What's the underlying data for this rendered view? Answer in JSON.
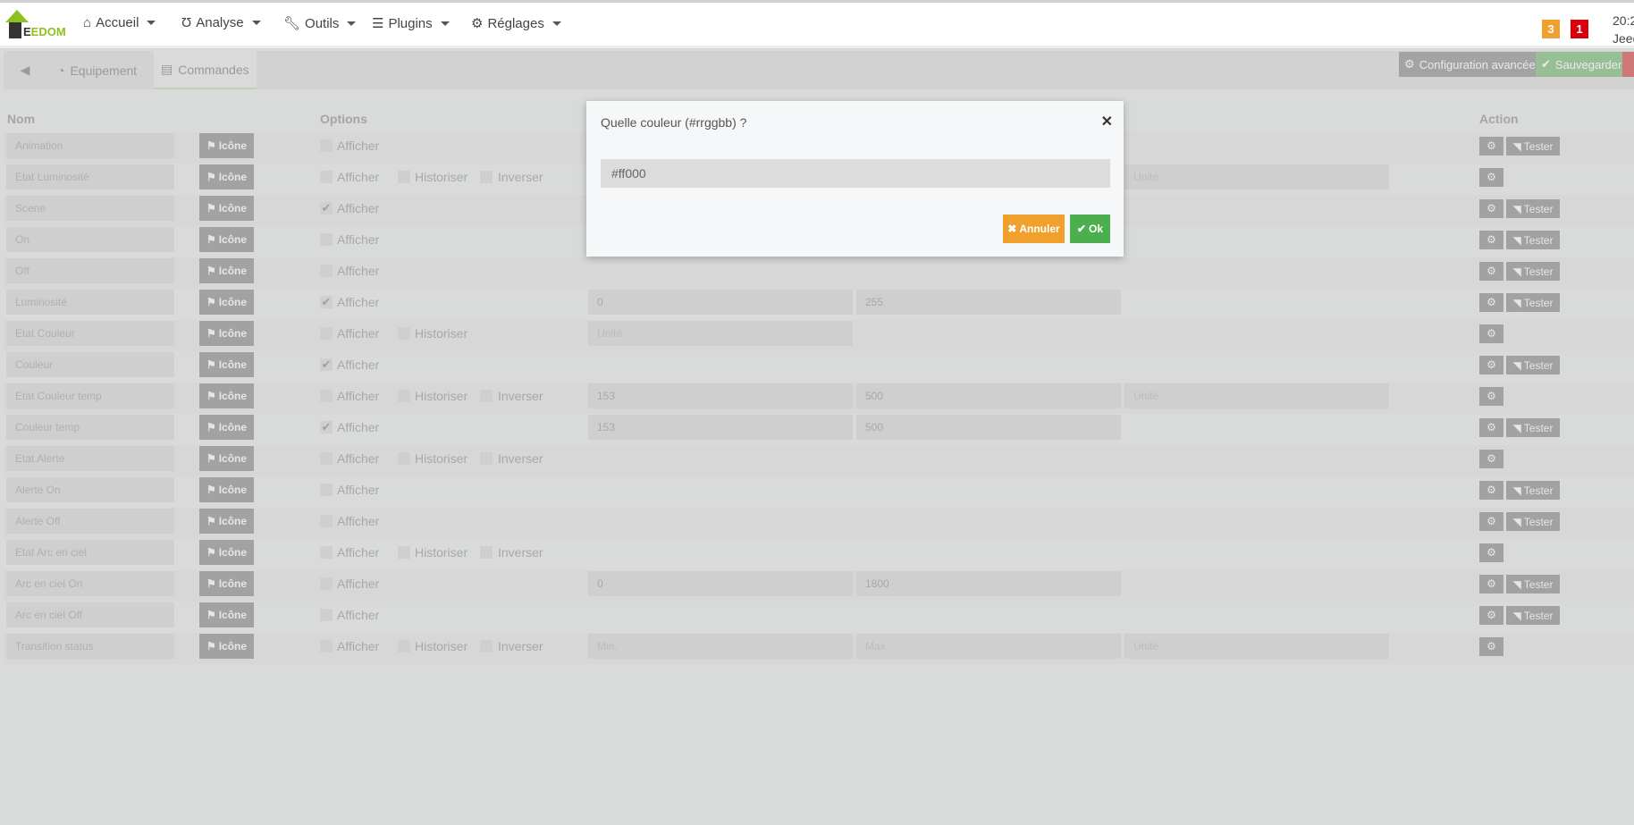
{
  "navbar": {
    "logo_text": "JEEDOM",
    "menus": [
      {
        "label": "Accueil",
        "icon": "home-icon"
      },
      {
        "label": "Analyse",
        "icon": "stethoscope-icon"
      },
      {
        "label": "Outils",
        "icon": "wrench-icon"
      },
      {
        "label": "Plugins",
        "icon": "tasks-icon"
      },
      {
        "label": "Réglages",
        "icon": "cog-icon"
      }
    ],
    "badges": [
      {
        "value": "3",
        "color": "#f0a02c"
      },
      {
        "value": "1",
        "color": "#d9000c"
      }
    ],
    "time": "20:2",
    "user": "Jeed"
  },
  "tabs": {
    "equipement": "Equipement",
    "commandes": "Commandes"
  },
  "toolbar": {
    "config": "Configuration avancée",
    "save": "Sauvegarder"
  },
  "table": {
    "headers": {
      "nom": "Nom",
      "options": "Options",
      "action": "Action"
    },
    "icon_label": "Icône",
    "afficher": "Afficher",
    "historiser": "Historiser",
    "inverser": "Inverser",
    "tester": "Tester",
    "rows": [
      {
        "name": "Animation",
        "afficher": false,
        "hist": false,
        "inv": false,
        "inputs": [],
        "tester": true
      },
      {
        "name": "Etat Luminosité",
        "afficher": false,
        "hist": true,
        "inv": true,
        "inputs": [
          null,
          null,
          {
            "ph": "Unité"
          }
        ],
        "tester": false
      },
      {
        "name": "Scene",
        "afficher": true,
        "hist": false,
        "inv": false,
        "inputs": [],
        "tester": true
      },
      {
        "name": "On",
        "afficher": false,
        "hist": false,
        "inv": false,
        "inputs": [],
        "tester": true
      },
      {
        "name": "Off",
        "afficher": false,
        "hist": false,
        "inv": false,
        "inputs": [],
        "tester": true
      },
      {
        "name": "Luminosité",
        "afficher": true,
        "hist": false,
        "inv": false,
        "inputs": [
          {
            "v": "0"
          },
          {
            "v": "255"
          }
        ],
        "tester": true
      },
      {
        "name": "Etat Couleur",
        "afficher": false,
        "hist": true,
        "inv": false,
        "inputs": [
          {
            "ph": "Unité"
          }
        ],
        "tester": false
      },
      {
        "name": "Couleur",
        "afficher": true,
        "hist": false,
        "inv": false,
        "inputs": [],
        "tester": true
      },
      {
        "name": "Etat Couleur temp",
        "afficher": false,
        "hist": true,
        "inv": true,
        "inputs": [
          {
            "v": "153"
          },
          {
            "v": "500"
          },
          {
            "ph": "Unité"
          }
        ],
        "tester": false
      },
      {
        "name": "Couleur temp",
        "afficher": true,
        "hist": false,
        "inv": false,
        "inputs": [
          {
            "v": "153"
          },
          {
            "v": "500"
          }
        ],
        "tester": true
      },
      {
        "name": "Etat Alerte",
        "afficher": false,
        "hist": true,
        "inv": true,
        "inputs": [],
        "tester": false
      },
      {
        "name": "Alerte On",
        "afficher": false,
        "hist": false,
        "inv": false,
        "inputs": [],
        "tester": true
      },
      {
        "name": "Alerte Off",
        "afficher": false,
        "hist": false,
        "inv": false,
        "inputs": [],
        "tester": true
      },
      {
        "name": "Etat Arc en ciel",
        "afficher": false,
        "hist": true,
        "inv": true,
        "inputs": [],
        "tester": false
      },
      {
        "name": "Arc en ciel On",
        "afficher": false,
        "hist": false,
        "inv": false,
        "inputs": [
          {
            "v": "0"
          },
          {
            "v": "1800"
          }
        ],
        "tester": true
      },
      {
        "name": "Arc en ciel Off",
        "afficher": false,
        "hist": false,
        "inv": false,
        "inputs": [],
        "tester": true
      },
      {
        "name": "Transition status",
        "afficher": false,
        "hist": true,
        "inv": true,
        "inputs": [
          {
            "ph": "Min."
          },
          {
            "ph": "Max."
          },
          {
            "ph": "Unité"
          }
        ],
        "tester": false
      }
    ]
  },
  "modal": {
    "title": "Quelle couleur (#rrggbb) ?",
    "value": "#ff000",
    "cancel": "Annuler",
    "ok": "Ok",
    "cancel_color": "#f0a02c",
    "ok_color": "#4cae4c"
  }
}
